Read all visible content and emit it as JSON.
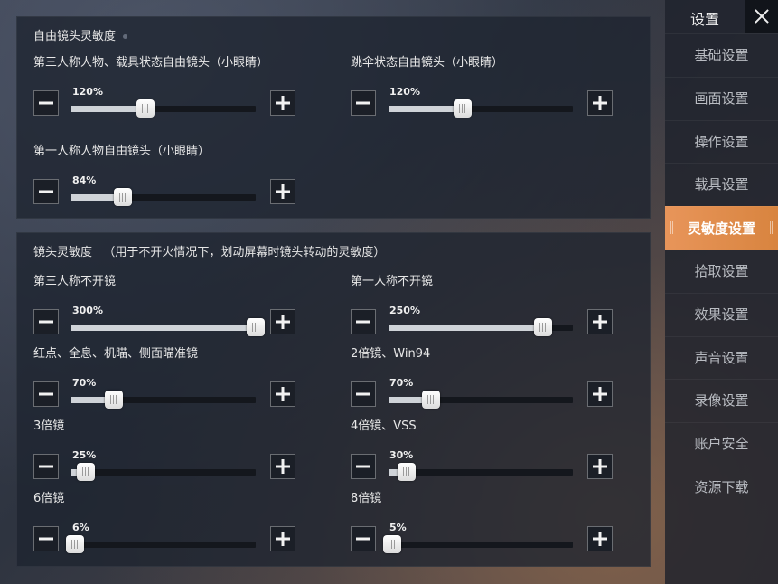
{
  "panel1": {
    "title": "自由镜头灵敏度",
    "sliders": [
      {
        "label": "第三人称人物、载具状态自由镜头（小眼睛）",
        "value": "120%",
        "level": 0.4
      },
      {
        "label": "跳伞状态自由镜头（小眼睛）",
        "value": "120%",
        "level": 0.4
      },
      {
        "label": "第一人称人物自由镜头（小眼睛）",
        "value": "84%",
        "level": 0.28
      }
    ]
  },
  "panel2": {
    "title": "镜头灵敏度",
    "subtitle": "（用于不开火情况下，划动屏幕时镜头转动的灵敏度）",
    "sliders": [
      {
        "label": "第三人称不开镜",
        "value": "300%",
        "level": 1.0
      },
      {
        "label": "第一人称不开镜",
        "value": "250%",
        "level": 0.84
      },
      {
        "label": "红点、全息、机瞄、侧面瞄准镜",
        "value": "70%",
        "level": 0.23
      },
      {
        "label": "2倍镜、Win94",
        "value": "70%",
        "level": 0.23
      },
      {
        "label": "3倍镜",
        "value": "25%",
        "level": 0.08
      },
      {
        "label": "4倍镜、VSS",
        "value": "30%",
        "level": 0.1
      },
      {
        "label": "6倍镜",
        "value": "6%",
        "level": 0.02
      },
      {
        "label": "8倍镜",
        "value": "5%",
        "level": 0.017
      }
    ]
  },
  "sidebar": {
    "title": "设置",
    "items": [
      {
        "label": "基础设置",
        "active": false
      },
      {
        "label": "画面设置",
        "active": false
      },
      {
        "label": "操作设置",
        "active": false
      },
      {
        "label": "载具设置",
        "active": false
      },
      {
        "label": "灵敏度设置",
        "active": true
      },
      {
        "label": "拾取设置",
        "active": false
      },
      {
        "label": "效果设置",
        "active": false
      },
      {
        "label": "声音设置",
        "active": false
      },
      {
        "label": "录像设置",
        "active": false
      },
      {
        "label": "账户安全",
        "active": false
      },
      {
        "label": "资源下载",
        "active": false
      }
    ]
  },
  "colors": {
    "accent": "#e8955a",
    "fill": "#cfd3d8",
    "track": "#14171d"
  }
}
